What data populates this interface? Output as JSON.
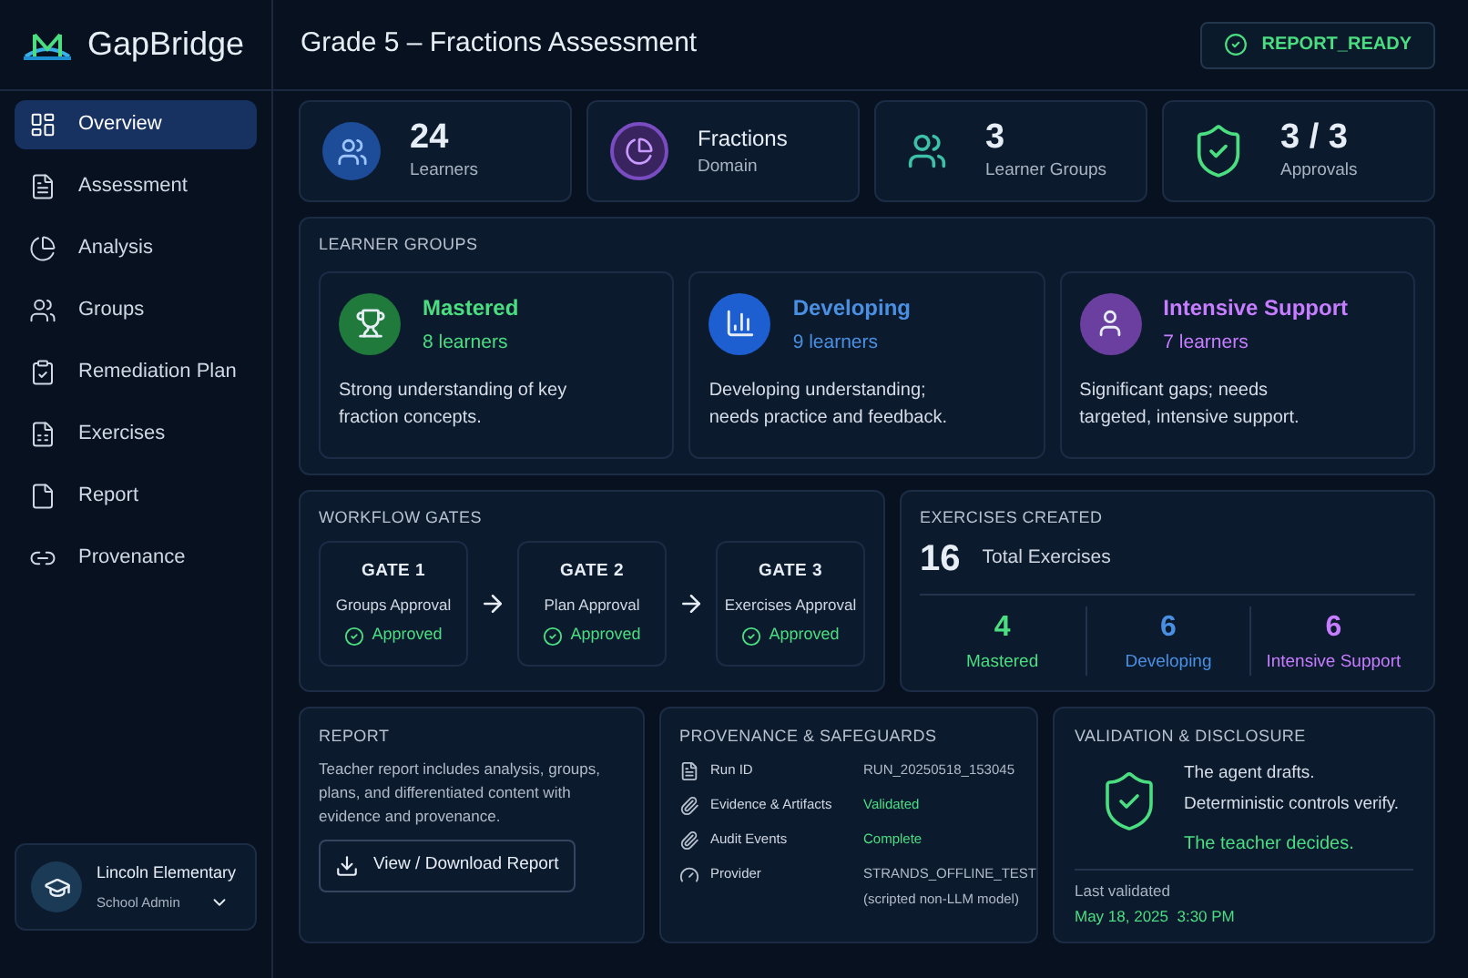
{
  "brand": "GapBridge",
  "nav": [
    {
      "label": "Overview",
      "selected": true
    },
    {
      "label": "Assessment",
      "selected": false
    },
    {
      "label": "Analysis",
      "selected": false
    },
    {
      "label": "Groups",
      "selected": false
    },
    {
      "label": "Remediation Plan",
      "selected": false
    },
    {
      "label": "Exercises",
      "selected": false
    },
    {
      "label": "Report",
      "selected": false
    },
    {
      "label": "Provenance",
      "selected": false
    }
  ],
  "user": {
    "name": "Lincoln Elementary",
    "role": "School Admin"
  },
  "title": "Grade 5 – Fractions Assessment",
  "status_badge": "REPORT_READY",
  "stats": [
    {
      "kind": "learners",
      "value": "24",
      "label": "Learners"
    },
    {
      "kind": "domain",
      "value": "Fractions",
      "label": "Domain"
    },
    {
      "kind": "groups",
      "value": "3",
      "label": "Learner Groups"
    },
    {
      "kind": "approvals",
      "value": "3 / 3",
      "label": "Approvals"
    }
  ],
  "learner_groups": {
    "title": "LEARNER GROUPS",
    "groups": [
      {
        "kind": "mastered",
        "name": "Mastered",
        "count": "8 learners",
        "description": "Strong understanding of key fraction concepts.",
        "color": "#4ade80"
      },
      {
        "kind": "developing",
        "name": "Developing",
        "count": "9 learners",
        "description": "Developing understanding; needs practice and feedback.",
        "color": "#4a90e2"
      },
      {
        "kind": "intensive",
        "name": "Intensive Support",
        "count": "7 learners",
        "description": "Significant gaps; needs targeted, intensive support.",
        "color": "#c77dff"
      }
    ]
  },
  "workflow_gates": {
    "title": "WORKFLOW GATES",
    "gates": [
      {
        "title": "GATE 1",
        "name": "Groups Approval",
        "status": "Approved",
        "approved": true
      },
      {
        "title": "GATE 2",
        "name": "Plan Approval",
        "status": "Approved",
        "approved": true
      },
      {
        "title": "GATE 3",
        "name": "Exercises Approval",
        "status": "Approved",
        "approved": true
      }
    ]
  },
  "exercises": {
    "title": "EXERCISES CREATED",
    "total": "16",
    "total_label": "Total Exercises",
    "breakdown": [
      {
        "value": "4",
        "label": "Mastered",
        "color": "#4ade80"
      },
      {
        "value": "6",
        "label": "Developing",
        "color": "#4a90e2"
      },
      {
        "value": "6",
        "label": "Intensive Support",
        "color": "#c77dff"
      }
    ]
  },
  "report": {
    "title": "REPORT",
    "text": "Teacher report includes analysis, groups, plans, and differentiated content with evidence and provenance.",
    "button": "View / Download Report"
  },
  "provenance": {
    "title": "PROVENANCE & SAFEGUARDS",
    "rows": [
      {
        "label": "Run ID",
        "value": "RUN_20250518_153045",
        "kind": "text"
      },
      {
        "label": "Evidence & Artifacts",
        "value": "Validated",
        "kind": "status"
      },
      {
        "label": "Audit Events",
        "value": "Complete",
        "kind": "status"
      },
      {
        "label": "Provider",
        "value": "STRANDS_OFFLINE_TEST",
        "note": "(scripted non-LLM model)",
        "kind": "text"
      }
    ]
  },
  "validation": {
    "title": "VALIDATION & DISCLOSURE",
    "lines": [
      "The agent drafts.",
      "Deterministic controls verify."
    ],
    "emphasis": "The teacher decides.",
    "last_label": "Last validated",
    "last_value": "May 18, 2025  3:30 PM"
  }
}
